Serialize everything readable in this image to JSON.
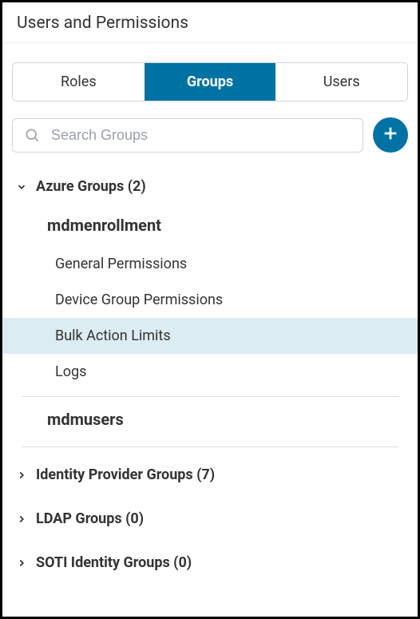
{
  "page": {
    "title": "Users and Permissions"
  },
  "tabs": {
    "roles": "Roles",
    "groups": "Groups",
    "users": "Users"
  },
  "search": {
    "placeholder": "Search Groups"
  },
  "tree": {
    "azure": {
      "label": "Azure Groups (2)",
      "groups": {
        "mdmenrollment": {
          "label": "mdmenrollment",
          "items": {
            "general": "General Permissions",
            "devicegroup": "Device Group Permissions",
            "bulk": "Bulk Action Limits",
            "logs": "Logs"
          }
        },
        "mdmusers": {
          "label": "mdmusers"
        }
      }
    },
    "idp": {
      "label": "Identity Provider Groups (7)"
    },
    "ldap": {
      "label": "LDAP Groups (0)"
    },
    "soti": {
      "label": "SOTI Identity Groups (0)"
    }
  }
}
